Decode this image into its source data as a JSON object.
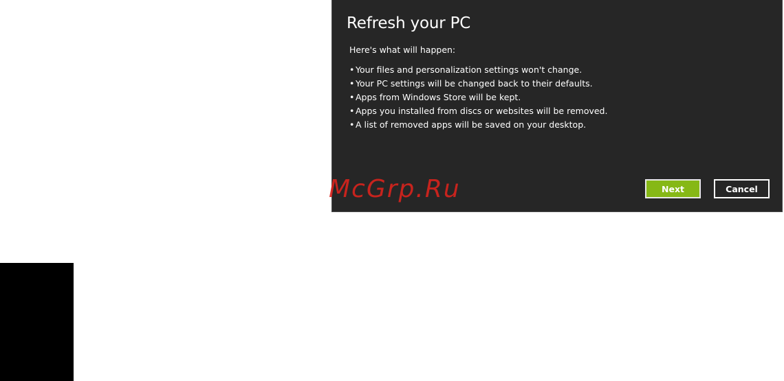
{
  "dialog": {
    "title": "Refresh your PC",
    "intro": "Here's what will happen:",
    "bullets": [
      "Your files and personalization settings won't change.",
      "Your PC settings will be changed back to their defaults.",
      "Apps from Windows Store will be kept.",
      "Apps you installed from discs or websites will be removed.",
      "A list of removed apps will be saved on your desktop."
    ],
    "next_label": "Next",
    "cancel_label": "Cancel"
  },
  "watermark": "McGrp.Ru",
  "colors": {
    "dialog_background": "#262626",
    "next_button": "#86b816",
    "watermark": "#d9231d"
  }
}
